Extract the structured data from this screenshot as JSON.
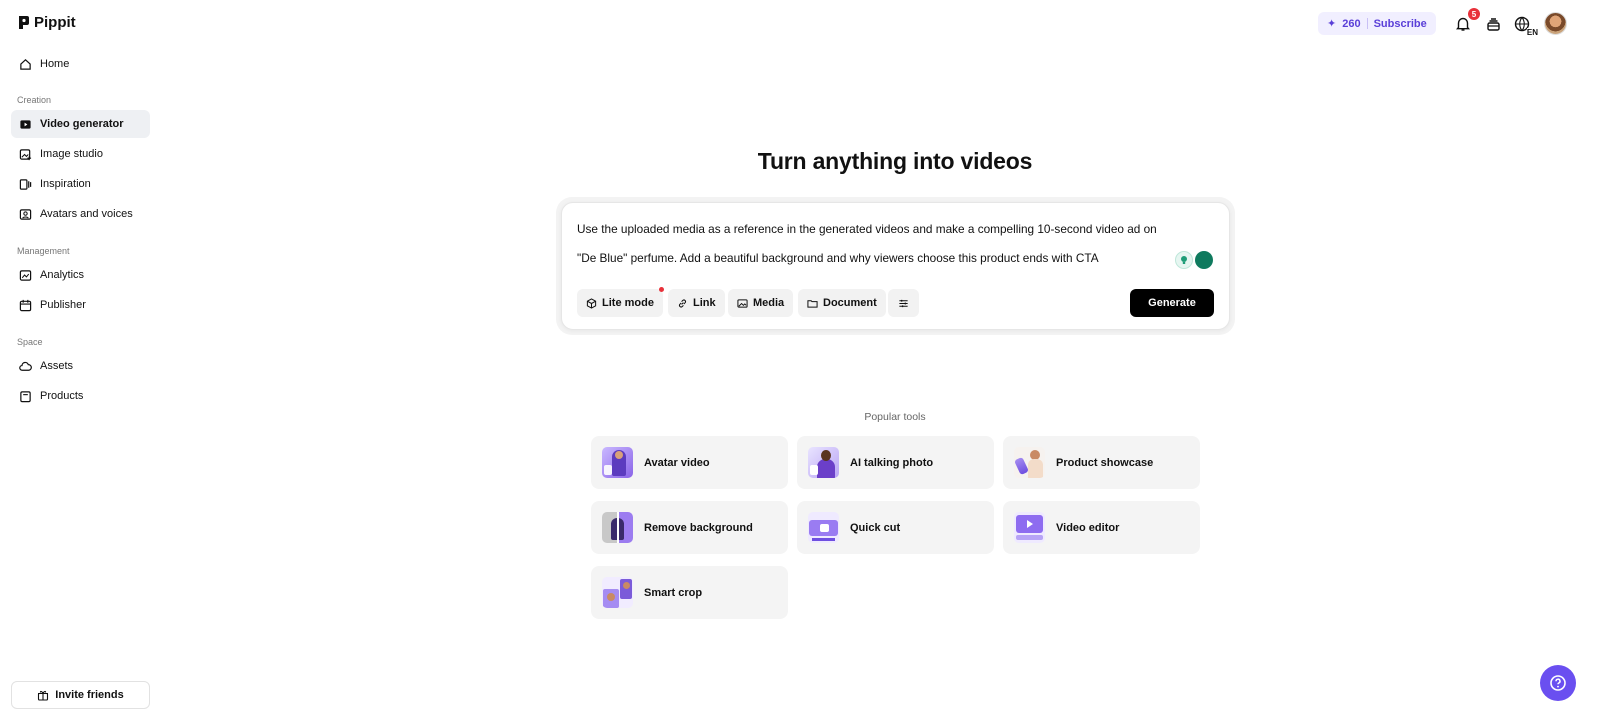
{
  "app": {
    "name": "Pippit"
  },
  "sidebar": {
    "home": "Home",
    "sections": {
      "creation": "Creation",
      "management": "Management",
      "space": "Space"
    },
    "creation_items": [
      "Video generator",
      "Image studio",
      "Inspiration",
      "Avatars and voices"
    ],
    "management_items": [
      "Analytics",
      "Publisher"
    ],
    "space_items": [
      "Assets",
      "Products"
    ],
    "active_item": "Video generator",
    "invite_label": "Invite friends"
  },
  "header": {
    "credits": "260",
    "subscribe_label": "Subscribe",
    "notification_count": "5",
    "language": "EN"
  },
  "main": {
    "title": "Turn anything into videos",
    "prompt": {
      "line1": "Use the uploaded media as a reference in the generated videos and make a compelling 10-second video ad on",
      "line2": "\"De Blue\" perfume. Add a beautiful background and why viewers choose this product ends with CTA"
    },
    "chips": {
      "lite_mode": "Lite mode",
      "link": "Link",
      "media": "Media",
      "document": "Document"
    },
    "generate_label": "Generate",
    "popular_tools_label": "Popular tools",
    "tools": [
      {
        "label": "Avatar video",
        "icon": "avatar-video-thumb"
      },
      {
        "label": "AI talking photo",
        "icon": "talking-photo-thumb"
      },
      {
        "label": "Product showcase",
        "icon": "product-showcase-thumb"
      },
      {
        "label": "Remove background",
        "icon": "remove-background-thumb"
      },
      {
        "label": "Quick cut",
        "icon": "quick-cut-thumb"
      },
      {
        "label": "Video editor",
        "icon": "video-editor-thumb"
      },
      {
        "label": "Smart crop",
        "icon": "smart-crop-thumb"
      }
    ]
  },
  "colors": {
    "accent": "#6a4ff0",
    "credits_text": "#5a3fd8",
    "badge": "#e8313a",
    "generate_bg": "#000000",
    "active_nav_bg": "#eef0f3"
  }
}
